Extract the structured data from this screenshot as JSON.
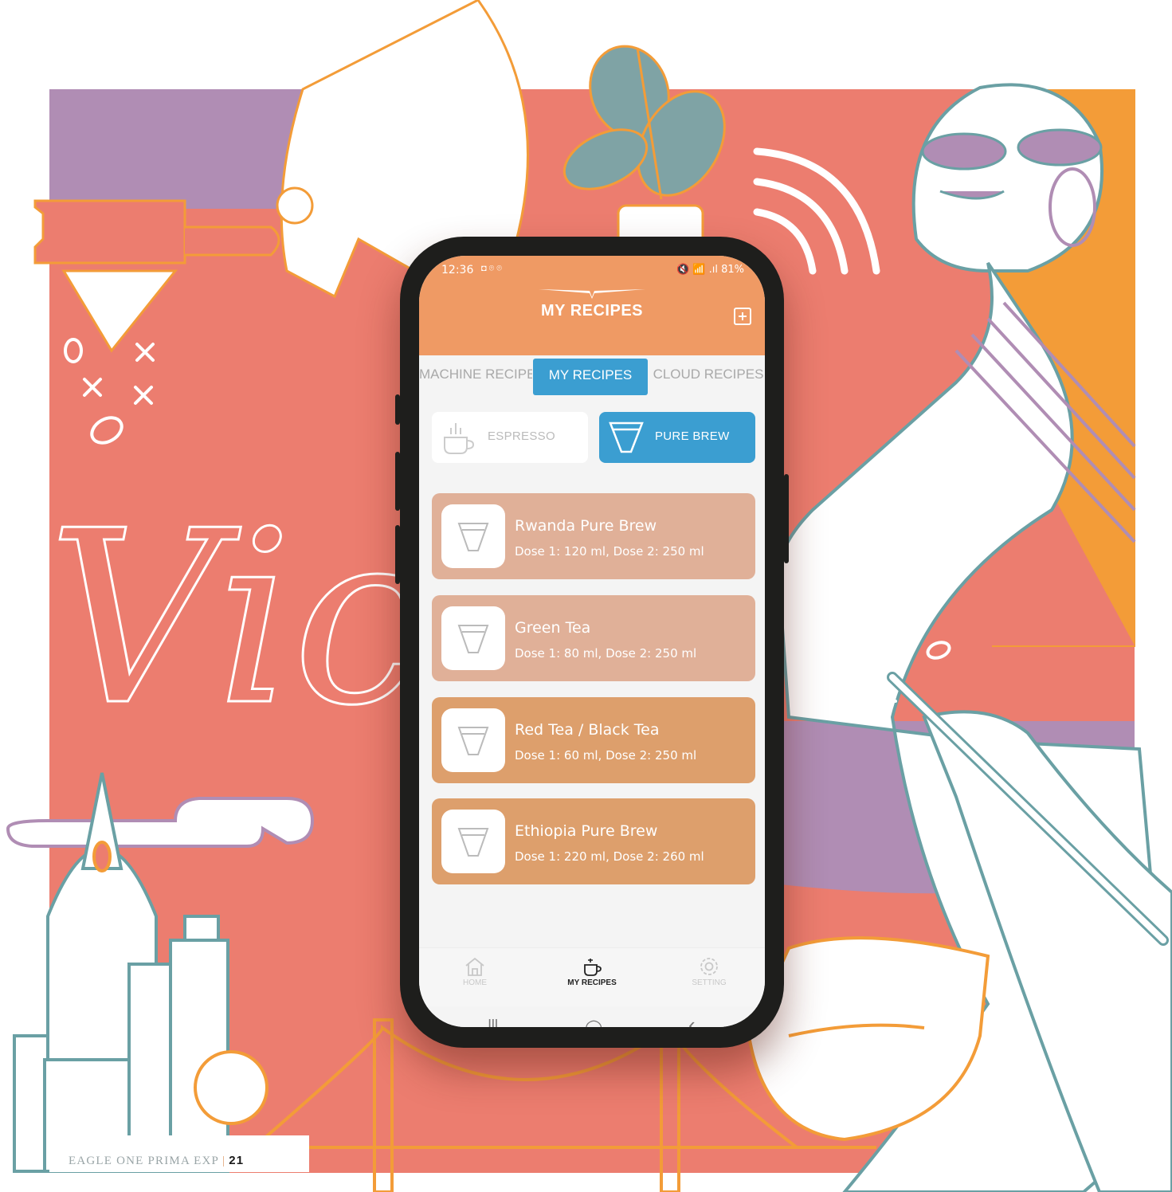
{
  "status_bar": {
    "time": "12:36",
    "indicators": "◘ ⌾ ⌾",
    "right": "🔇 📶 .ıl 81%"
  },
  "header": {
    "title": "MY RECIPES",
    "add_icon": "plus-square-icon"
  },
  "tabs": [
    {
      "label": "MACHINE RECIPE",
      "active": false
    },
    {
      "label": "MY RECIPES",
      "active": true
    },
    {
      "label": "CLOUD RECIPES",
      "active": false
    }
  ],
  "types": [
    {
      "label": "ESPRESSO",
      "icon": "cup-icon",
      "active": false
    },
    {
      "label": "PURE BREW",
      "icon": "filter-icon",
      "active": true
    }
  ],
  "recipes": [
    {
      "name": "Rwanda Pure Brew",
      "dose": "Dose 1: 120 ml, Dose 2: 250 ml",
      "color": "#e0b098"
    },
    {
      "name": "Green Tea",
      "dose": "Dose 1: 80 ml, Dose 2: 250 ml",
      "color": "#e0b098"
    },
    {
      "name": "Red Tea / Black Tea",
      "dose": "Dose 1: 60 ml, Dose 2: 250 ml",
      "color": "#dd9f6c"
    },
    {
      "name": "Ethiopia Pure Brew",
      "dose": "Dose 1: 220 ml, Dose 2: 260 ml",
      "color": "#dd9f6c"
    }
  ],
  "bottom_nav": [
    {
      "label": "HOME",
      "icon": "home-icon",
      "active": false
    },
    {
      "label": "MY RECIPES",
      "icon": "cup-icon",
      "active": true
    },
    {
      "label": "SETTING",
      "icon": "gear-icon",
      "active": false
    }
  ],
  "system_nav": {
    "recents": "|||",
    "home": "◯",
    "back": "‹"
  },
  "footer": {
    "text": "EAGLE ONE PRIMA EXP",
    "separator": "|",
    "page": "21"
  },
  "colors": {
    "header": "#ef9a64",
    "accent_blue": "#3b9ed1",
    "background_coral": "#ec7d6f",
    "lilac": "#b08db4",
    "orange": "#f39c38"
  }
}
